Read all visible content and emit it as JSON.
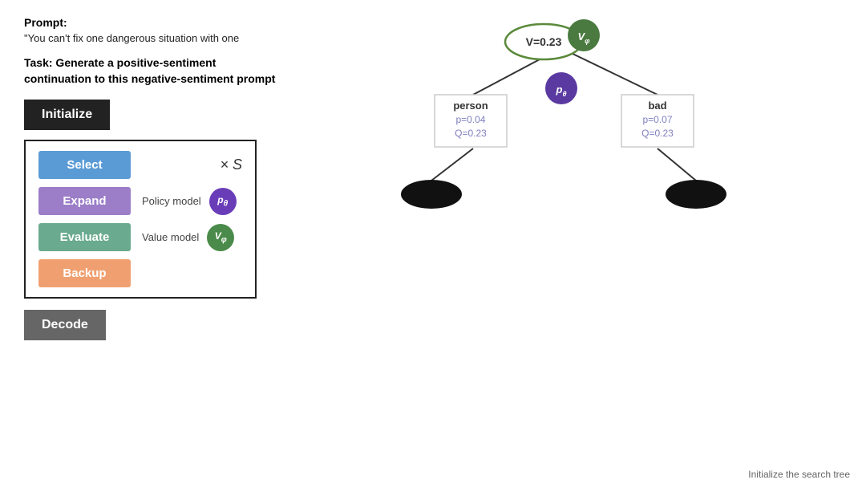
{
  "prompt": {
    "label": "Prompt:",
    "text": "\"You can't fix one dangerous situation with one"
  },
  "task": {
    "text": "Task: Generate a positive-sentiment continuation to this negative-sentiment prompt"
  },
  "buttons": {
    "initialize": "Initialize",
    "decode": "Decode",
    "select": "Select",
    "expand": "Expand",
    "evaluate": "Evaluate",
    "backup": "Backup"
  },
  "steps": {
    "times_s": "× S",
    "expand_label": "Policy model",
    "evaluate_label": "Value model",
    "policy_icon": "p_θ",
    "value_icon": "V_φ"
  },
  "tree": {
    "root_label": "V=0.23",
    "root_vφ": "V_φ",
    "left_node": {
      "word": "person",
      "p": "p=0.04",
      "q": "Q=0.23"
    },
    "right_node": {
      "word": "bad",
      "p": "p=0.07",
      "q": "Q=0.23"
    },
    "pθ_label": "p_θ"
  },
  "status": "Initialize the search tree"
}
